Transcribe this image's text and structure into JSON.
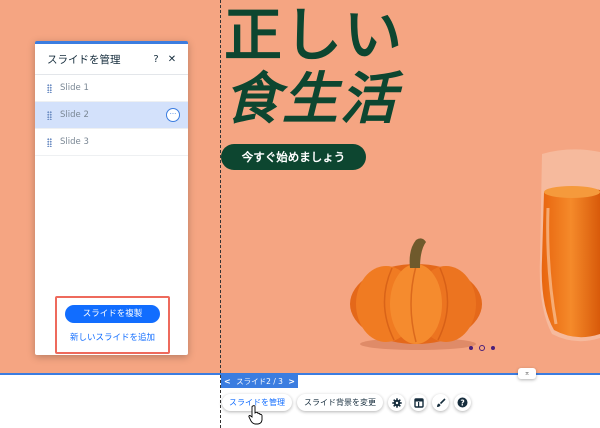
{
  "hero": {
    "headline_line1": "正しい",
    "headline_line2": "食生活",
    "cta_label": "今すぐ始めましょう"
  },
  "panel": {
    "title": "スライドを管理",
    "help_icon_label": "?",
    "close_icon_label": "✕",
    "slides": [
      {
        "label": "Slide 1",
        "selected": false
      },
      {
        "label": "Slide 2",
        "selected": true
      },
      {
        "label": "Slide 3",
        "selected": false
      }
    ],
    "more_label": "···",
    "duplicate_button": "スライドを複製",
    "add_link": "新しいスライドを追加"
  },
  "slideshow_nav": {
    "prev": "<",
    "label": "スライド2 / 3",
    "next": ">"
  },
  "toolbar": {
    "manage_label": "スライドを管理",
    "change_bg_label": "スライド背景を変更"
  },
  "colors": {
    "canvas_bg": "#f5a582",
    "headline": "#0d4630",
    "accent_blue": "#116dff",
    "highlight_box": "#ee6a5c"
  },
  "slide_dots": {
    "count": 3,
    "active_index": 1
  }
}
